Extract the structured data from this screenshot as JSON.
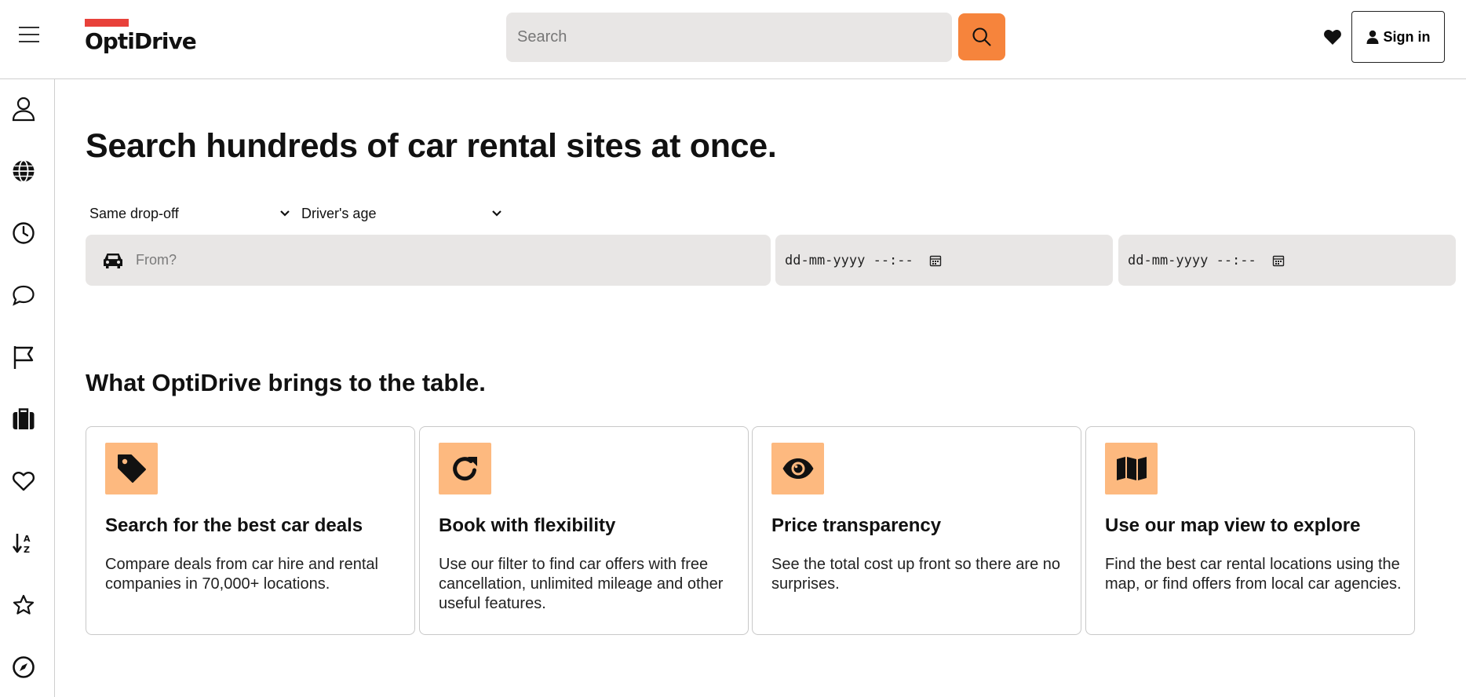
{
  "header": {
    "brand": "OptiDrive",
    "search_placeholder": "Search",
    "signin_label": "Sign in"
  },
  "sidebar": {
    "items": [
      {
        "icon": "user-icon"
      },
      {
        "icon": "globe-icon"
      },
      {
        "icon": "clock-icon"
      },
      {
        "icon": "chat-icon"
      },
      {
        "icon": "flag-icon"
      },
      {
        "icon": "luggage-icon"
      },
      {
        "icon": "heart-icon"
      },
      {
        "icon": "sort-icon"
      },
      {
        "icon": "star-icon"
      },
      {
        "icon": "compass-icon"
      }
    ]
  },
  "main": {
    "headline": "Search hundreds of car rental sites at once.",
    "dropoff_select": "Same drop-off",
    "age_select": "Driver's age",
    "from_placeholder": "From?",
    "pickup_date": "dd-mm-yyyy --:--",
    "dropoff_date": "dd-mm-yyyy --:--",
    "section_title": "What OptiDrive brings to the table.",
    "cards": [
      {
        "icon": "tag-icon",
        "title": "Search for the best car deals",
        "text": "Compare deals from car hire and rental companies in 70,000+ locations."
      },
      {
        "icon": "refresh-icon",
        "title": "Book with flexibility",
        "text": "Use our filter to find car offers with free cancellation, unlimited mileage and other useful features."
      },
      {
        "icon": "eye-icon",
        "title": "Price transparency",
        "text": "See the total cost up front so there are no surprises."
      },
      {
        "icon": "map-icon",
        "title": "Use our map view to explore",
        "text": "Find the best car rental locations using the map, or find offers from local car agencies."
      }
    ]
  },
  "colors": {
    "accent": "#f6843c",
    "icon_bg": "#fdb97f",
    "logo_bar": "#e8413a",
    "field_bg": "#e8e6e5"
  }
}
